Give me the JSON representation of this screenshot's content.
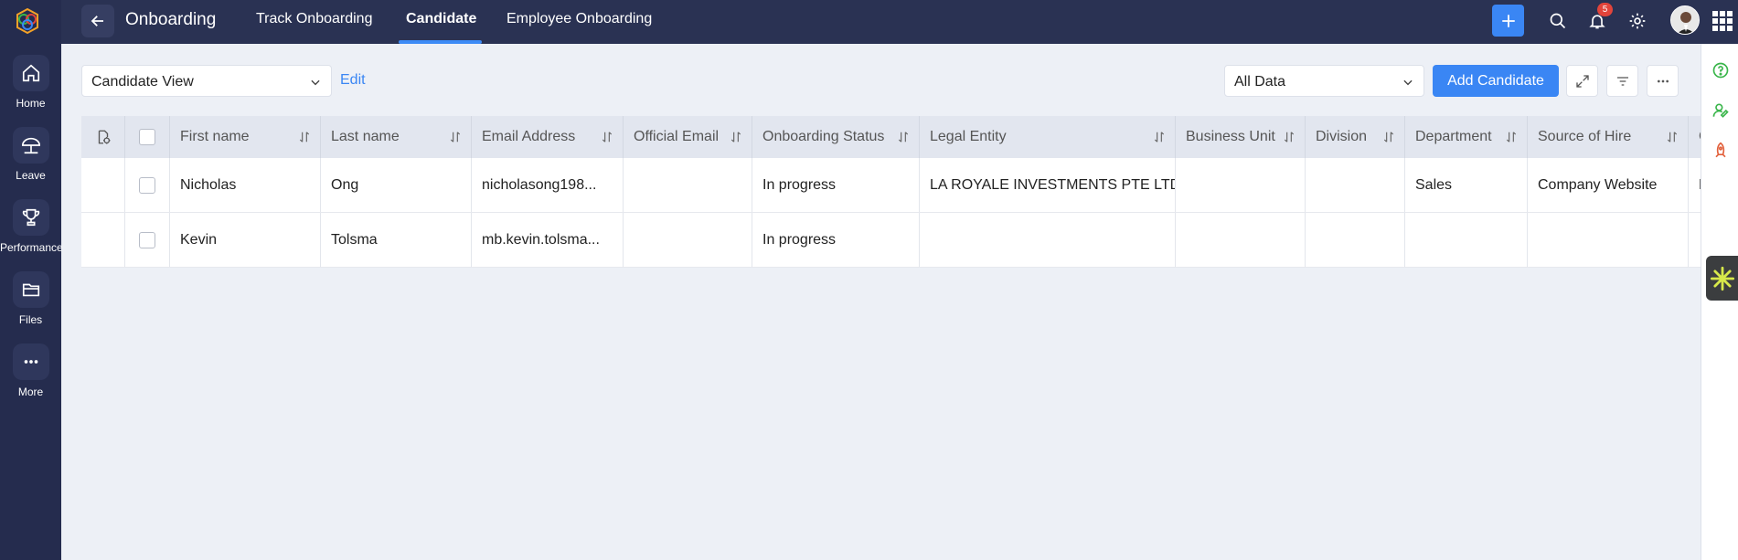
{
  "topbar": {
    "app_title": "Onboarding",
    "tabs": [
      {
        "label": "Track Onboarding",
        "active": false
      },
      {
        "label": "Candidate",
        "active": true
      },
      {
        "label": "Employee Onboarding",
        "active": false
      }
    ],
    "notification_count": "5"
  },
  "sidebar": {
    "items": [
      {
        "label": "Home",
        "icon": "home-icon"
      },
      {
        "label": "Leave",
        "icon": "umbrella-icon"
      },
      {
        "label": "Performance",
        "icon": "trophy-icon"
      },
      {
        "label": "Files",
        "icon": "folder-icon"
      },
      {
        "label": "More",
        "icon": "more-dots-icon"
      }
    ]
  },
  "toolbar": {
    "view_selected": "Candidate View",
    "edit_label": "Edit",
    "data_selected": "All Data",
    "add_label": "Add Candidate"
  },
  "table": {
    "columns": [
      "First name",
      "Last name",
      "Email Address",
      "Official Email",
      "Onboarding Status",
      "Legal Entity",
      "Business Unit",
      "Division",
      "Department",
      "Source of Hire",
      "G"
    ],
    "rows": [
      [
        "Nicholas",
        "Ong",
        "nicholasong198...",
        "",
        "In progress",
        "LA ROYALE INVESTMENTS PTE LTD",
        "",
        "",
        "Sales",
        "Company Website",
        "M"
      ],
      [
        "Kevin",
        "Tolsma",
        "mb.kevin.tolsma...",
        "",
        "In progress",
        "",
        "",
        "",
        "",
        "",
        ""
      ]
    ]
  },
  "colors": {
    "sidebar_bg": "#252c4e",
    "topbar_bg": "#2a3253",
    "accent": "#3a86f4",
    "page_bg": "#edf0f6"
  }
}
